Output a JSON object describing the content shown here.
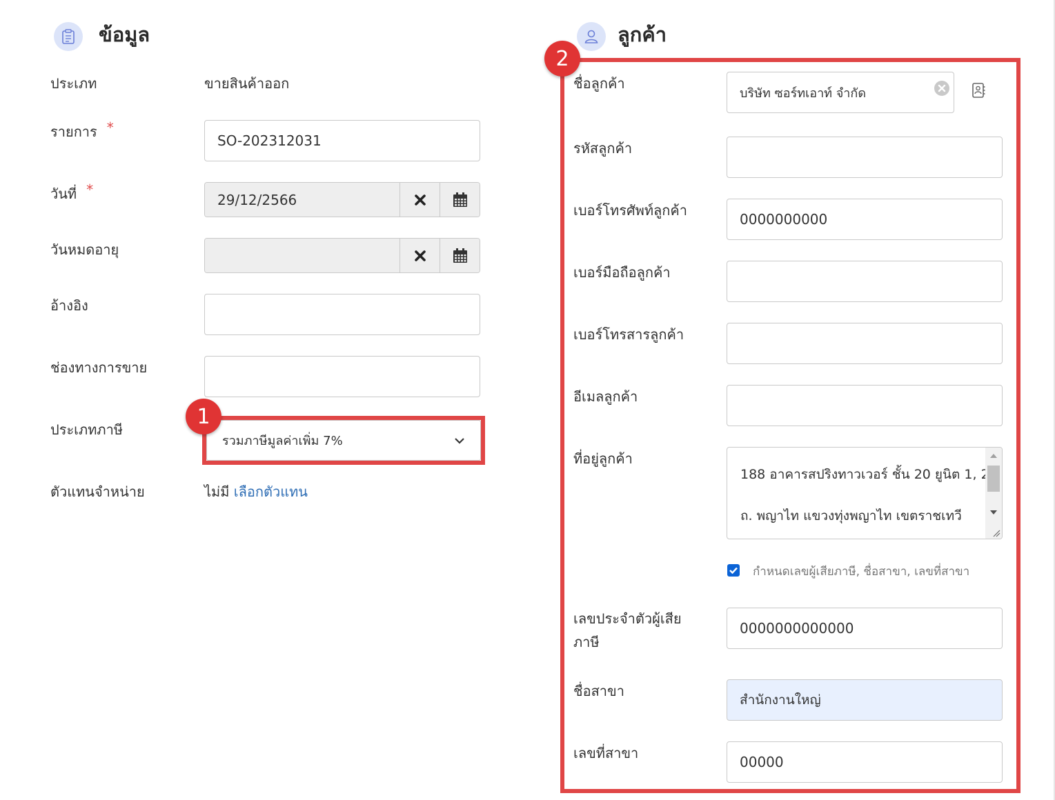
{
  "left_section": {
    "title": "ข้อมูล",
    "icon": "clipboard-icon",
    "type_label": "ประเภท",
    "type_value": "ขายสินค้าออก",
    "doc_label": "รายการ",
    "doc_value": "SO-202312031",
    "date_label": "วันที่",
    "date_value": "29/12/2566",
    "expiry_label": "วันหมดอายุ",
    "expiry_value": "",
    "reference_label": "อ้างอิง",
    "reference_value": "",
    "channel_label": "ช่องทางการขาย",
    "channel_value": "",
    "tax_type_label": "ประเภทภาษี",
    "tax_type_value": "รวมภาษีมูลค่าเพิ่ม 7%",
    "agent_label": "ตัวแทนจำหน่าย",
    "agent_value": "ไม่มี",
    "agent_link": "เลือกตัวแทน",
    "required_mark": "*"
  },
  "right_section": {
    "title": "ลูกค้า",
    "icon": "user-icon",
    "customer_name_label": "ชื่อลูกค้า",
    "customer_name_value": "บริษัท ซอร์ทเอาท์ จำกัด",
    "customer_code_label": "รหัสลูกค้า",
    "customer_code_value": "",
    "phone_label": "เบอร์โทรศัพท์ลูกค้า",
    "phone_value": "0000000000",
    "mobile_label": "เบอร์มือถือลูกค้า",
    "mobile_value": "",
    "fax_label": "เบอร์โทรสารลูกค้า",
    "fax_value": "",
    "email_label": "อีเมลลูกค้า",
    "email_value": "",
    "address_label": "ที่อยู่ลูกค้า",
    "address_lines": [
      "188 อาคารสปริงทาวเวอร์ ชั้น 20 ยูนิต 1, 2",
      "ถ. พญาไท แขวงทุ่งพญาไท เขตราชเทวี"
    ],
    "checkbox_label": "กำหนดเลขผู้เสียภาษี, ชื่อสาขา, เลขที่สาขา",
    "checkbox_checked": true,
    "tax_id_label_line1": "เลขประจำตัวผู้เสีย",
    "tax_id_label_line2": "ภาษี",
    "tax_id_value": "0000000000000",
    "branch_name_label": "ชื่อสาขา",
    "branch_name_value": "สำนักงานใหญ่",
    "branch_no_label": "เลขที่สาขา",
    "branch_no_value": "00000"
  },
  "annotations": {
    "badge_1": "1",
    "badge_2": "2",
    "highlight_color": "#e04646"
  }
}
